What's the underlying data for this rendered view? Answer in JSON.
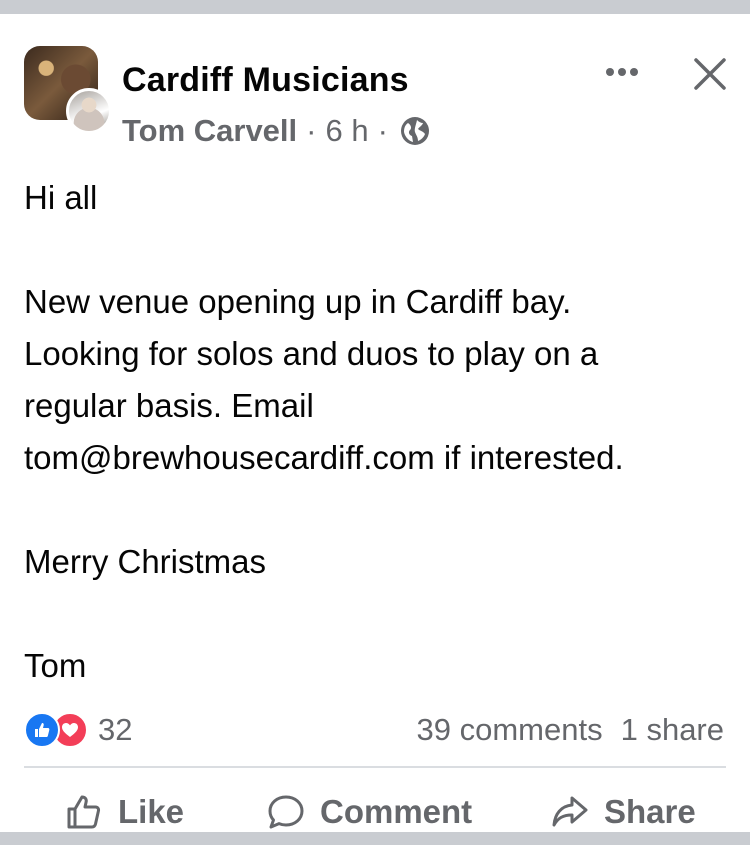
{
  "post": {
    "group_name": "Cardiff Musicians",
    "author": "Tom Carvell",
    "time": "6 h",
    "separator": "·",
    "text": "Hi all\n\nNew venue opening up in Cardiff bay.\nLooking for solos and duos to play on a\nregular basis. Email\ntom@brewhousecardiff.com if interested.\n\nMerry Christmas\n\nTom"
  },
  "stats": {
    "reactions_count": "32",
    "comments": "39 comments",
    "shares": "1 share"
  },
  "actions": {
    "like": "Like",
    "comment": "Comment",
    "share": "Share"
  },
  "icons": {
    "privacy": "globe-icon",
    "menu": "more-options-icon",
    "close": "close-icon"
  },
  "colors": {
    "like_blue": "#1877f2",
    "love_red": "#f33e58",
    "secondary_text": "#65676b"
  }
}
